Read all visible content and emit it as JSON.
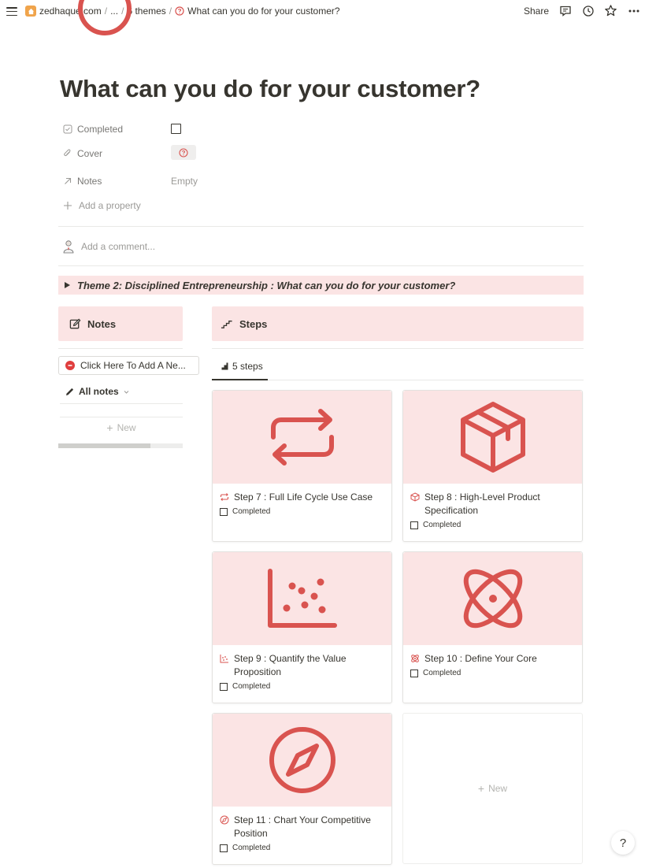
{
  "breadcrumb": {
    "workspace": "zedhaque.com",
    "ellipsis": "...",
    "parent": "6 themes",
    "current": "What can you do for your customer?",
    "separator": "/"
  },
  "topbar": {
    "share_label": "Share",
    "icons": [
      "comment-icon",
      "history-icon",
      "star-icon",
      "more-icon"
    ]
  },
  "page": {
    "title": "What can you do for your customer?",
    "accent_color": "#d9534f"
  },
  "properties": [
    {
      "icon": "checkbox-prop-icon",
      "name": "Completed",
      "value": ""
    },
    {
      "icon": "paperclip-icon",
      "name": "Cover",
      "value": ""
    },
    {
      "icon": "arrow-relation-icon",
      "name": "Notes",
      "value": "Empty"
    }
  ],
  "add_property_label": "Add a property",
  "comment_placeholder": "Add a comment...",
  "toggle": {
    "text": "Theme 2: Disciplined Entrepreneurship : What can you do for your customer?"
  },
  "notes_panel": {
    "heading": "Notes",
    "add_button": "Click Here To Add A Ne...",
    "view_label": "All notes",
    "new_label": "New",
    "scroll_fraction": 0.74
  },
  "steps_panel": {
    "heading": "Steps",
    "tab_label": "5 steps",
    "new_label": "New",
    "cards": [
      {
        "title": "Step 7 : Full Life Cycle Use Case",
        "icon": "repeat-icon",
        "prop": "Completed",
        "checked": false
      },
      {
        "title": "Step 8 : High-Level Product Specification",
        "icon": "cube-icon",
        "prop": "Completed",
        "checked": false
      },
      {
        "title": "Step 9 : Quantify the Value Proposition",
        "icon": "scatter-chart-icon",
        "prop": "Completed",
        "checked": false
      },
      {
        "title": "Step 10 : Define Your Core",
        "icon": "atom-icon",
        "prop": "Completed",
        "checked": false
      },
      {
        "title": "Step 11 : Chart Your Competitive Position",
        "icon": "compass-icon",
        "prop": "Completed",
        "checked": false
      }
    ]
  },
  "help_label": "?"
}
